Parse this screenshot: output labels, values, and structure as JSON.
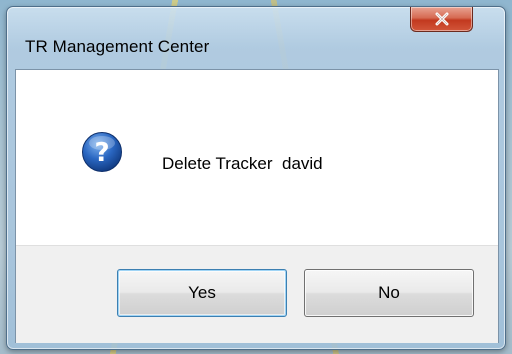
{
  "window": {
    "title": "TR Management Center"
  },
  "dialog": {
    "icon": "question-icon",
    "message": "Delete Tracker  david"
  },
  "buttons": {
    "yes_label": "Yes",
    "no_label": "No"
  },
  "colors": {
    "close_button": "#c8432a",
    "icon_blue": "#1f5fb3",
    "button_bar": "#f0f0f0"
  }
}
